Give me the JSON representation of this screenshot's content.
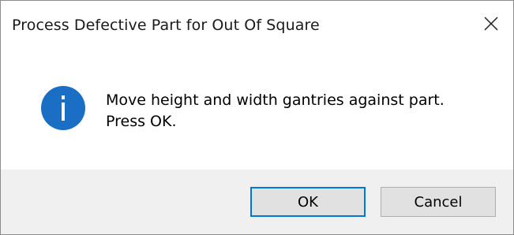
{
  "window": {
    "title": "Process Defective Part for Out Of Square",
    "close_icon": "close-icon"
  },
  "message": {
    "icon": "info-icon",
    "icon_color": "#1a6fc4",
    "line1": "Move height and width gantries against part.",
    "line2": "Press OK."
  },
  "buttons": {
    "ok_label": "OK",
    "cancel_label": "Cancel",
    "default_border_color": "#0078d7"
  }
}
